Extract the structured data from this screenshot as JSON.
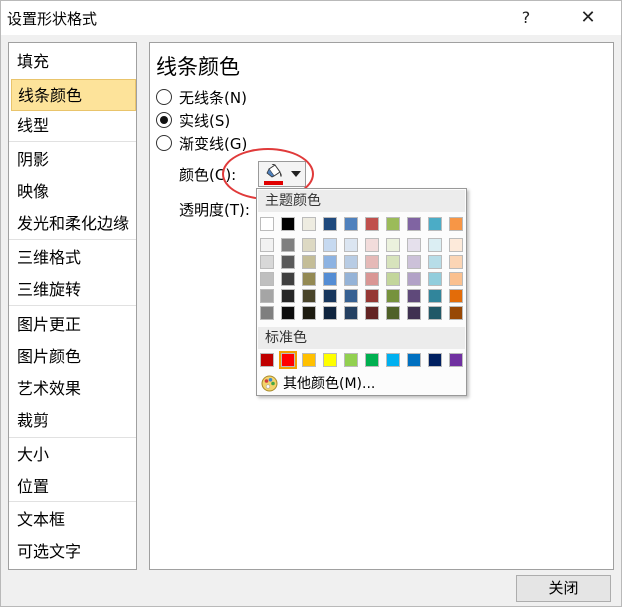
{
  "window": {
    "title": "设置形状格式",
    "help_label": "?",
    "close_label": "✕"
  },
  "nav": {
    "items": [
      {
        "label": "填充"
      },
      {
        "label": "线条颜色"
      },
      {
        "label": "线型"
      },
      {
        "label": "阴影"
      },
      {
        "label": "映像"
      },
      {
        "label": "发光和柔化边缘"
      },
      {
        "label": "三维格式"
      },
      {
        "label": "三维旋转"
      },
      {
        "label": "图片更正"
      },
      {
        "label": "图片颜色"
      },
      {
        "label": "艺术效果"
      },
      {
        "label": "裁剪"
      },
      {
        "label": "大小"
      },
      {
        "label": "位置"
      },
      {
        "label": "文本框"
      },
      {
        "label": "可选文字"
      }
    ],
    "selected": "线条颜色"
  },
  "panel": {
    "heading": "线条颜色",
    "options": [
      {
        "label": "无线条(N)",
        "checked": false
      },
      {
        "label": "实线(S)",
        "checked": true
      },
      {
        "label": "渐变线(G)",
        "checked": false
      }
    ],
    "color_label": "颜色(C):",
    "transparency_label": "透明度(T):",
    "current_color": "#e00000"
  },
  "color_popup": {
    "theme_header": "主题颜色",
    "standard_header": "标准色",
    "more_colors": "其他颜色(M)...",
    "theme_top_row": [
      "#ffffff",
      "#000000",
      "#eeece1",
      "#1f497d",
      "#4f81bd",
      "#c0504d",
      "#9bbb59",
      "#8064a2",
      "#4bacc6",
      "#f79646"
    ],
    "theme_shades": [
      [
        "#f2f2f2",
        "#7f7f7f",
        "#ddd9c3",
        "#c6d9f0",
        "#dbe5f1",
        "#f2dcdb",
        "#ebf1dd",
        "#e5e0ec",
        "#dbeef3",
        "#fdeada"
      ],
      [
        "#d8d8d8",
        "#595959",
        "#c4bd97",
        "#8db3e2",
        "#b8cce4",
        "#e5b9b7",
        "#d7e3bc",
        "#ccc1d9",
        "#b7dde8",
        "#fbd5b5"
      ],
      [
        "#bfbfbf",
        "#3f3f3f",
        "#938953",
        "#548dd4",
        "#95b3d7",
        "#d99694",
        "#c3d69b",
        "#b2a2c7",
        "#92cddc",
        "#fac08f"
      ],
      [
        "#a5a5a5",
        "#262626",
        "#494429",
        "#17365d",
        "#366092",
        "#953734",
        "#76923c",
        "#5f497a",
        "#31859b",
        "#e36c09"
      ],
      [
        "#7f7f7f",
        "#0c0c0c",
        "#1d1b10",
        "#0f243e",
        "#244061",
        "#632423",
        "#4f6128",
        "#3f3151",
        "#205867",
        "#974806"
      ]
    ],
    "standard_colors": [
      "#c00000",
      "#ff0000",
      "#ffc000",
      "#ffff00",
      "#92d050",
      "#00b050",
      "#00b0f0",
      "#0070c0",
      "#002060",
      "#7030a0"
    ],
    "selected_standard": "#ff0000"
  },
  "footer": {
    "close_button": "关闭"
  }
}
